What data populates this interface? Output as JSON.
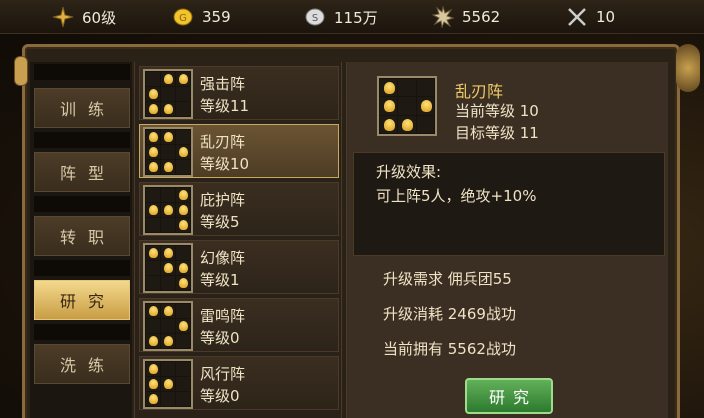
{
  "topbar": {
    "level": "60级",
    "gold": "359",
    "silver": "115万",
    "merit": "5562",
    "battles": "10"
  },
  "tabs": [
    {
      "label": "训练",
      "active": false
    },
    {
      "label": "阵型",
      "active": false
    },
    {
      "label": "转职",
      "active": false
    },
    {
      "label": "研究",
      "active": true
    },
    {
      "label": "洗练",
      "active": false
    }
  ],
  "formations": [
    {
      "name": "强击阵",
      "level": "等级11",
      "cells": [
        0,
        1,
        1,
        1,
        0,
        0,
        1,
        1,
        0
      ],
      "selected": false
    },
    {
      "name": "乱刃阵",
      "level": "等级10",
      "cells": [
        1,
        1,
        0,
        1,
        0,
        1,
        1,
        1,
        0
      ],
      "selected": true
    },
    {
      "name": "庇护阵",
      "level": "等级5",
      "cells": [
        0,
        0,
        1,
        1,
        1,
        1,
        0,
        0,
        1
      ],
      "selected": false
    },
    {
      "name": "幻像阵",
      "level": "等级1",
      "cells": [
        1,
        1,
        0,
        0,
        1,
        1,
        0,
        0,
        1
      ],
      "selected": false
    },
    {
      "name": "雷鸣阵",
      "level": "等级0",
      "cells": [
        1,
        1,
        0,
        0,
        0,
        1,
        1,
        1,
        0
      ],
      "selected": false
    },
    {
      "name": "风行阵",
      "level": "等级0",
      "cells": [
        1,
        0,
        0,
        1,
        1,
        0,
        1,
        0,
        0
      ],
      "selected": false
    }
  ],
  "detail": {
    "name": "乱刃阵",
    "current_level": "当前等级 10",
    "target_level": "目标等级 11",
    "cells": [
      1,
      0,
      0,
      1,
      0,
      1,
      1,
      1,
      0
    ],
    "effect_title": "升级效果:",
    "effect_text": "可上阵5人，绝攻+10%",
    "requirement": "升级需求 佣兵团55",
    "cost": "升级消耗 2469战功",
    "owned": "当前拥有 5562战功",
    "button_label": "研究"
  }
}
